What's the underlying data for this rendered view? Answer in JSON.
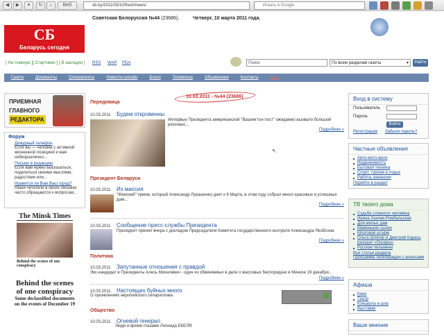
{
  "browser": {
    "url": "sb.by/2011/03/10/fresh/news/",
    "search_placeholder": "Искать в Google",
    "web_btn": "Веб"
  },
  "header": {
    "issue": "Советская Белоруссия №44",
    "issue_num": "(23686),",
    "date": "Четверг, 10 марта 2011 года.",
    "logo_big": "СБ",
    "logo_small": "Беларусь сегодня"
  },
  "toplinks": [
    "[ На главную ]",
    "[ Стартовая ]",
    "[ В закладки ]",
    "RSS",
    "WAP",
    "PDA"
  ],
  "search": {
    "placeholder": "Поиск",
    "scope": "По всем разделам газеты",
    "go": "Найти"
  },
  "nav": [
    "Газета",
    "Документы",
    "Спецпроекты",
    "Новости онлайн",
    "Блоги",
    "Телевизор",
    "Объявления",
    "Контакты",
    "Ещё"
  ],
  "left": {
    "promo_lines": [
      "ПРИЕМНАЯ",
      "ГЛАВНОГО",
      "РЕДАКТОРА"
    ],
    "forum_title": "Форум",
    "forum_items": [
      {
        "title": "Дежурный телефон",
        "text": "Если вы — человек с активной жизненной позицией и вам небезразлично..."
      },
      {
        "title": "Письмо в редакцию",
        "text": "Если вам нужно высказаться, поделиться своими мыслями, радостями или..."
      },
      {
        "title": "Нравится ли Вам Ваш город?",
        "text": "Наши читатели в своих письмах часто обращаются к вопросам..."
      }
    ],
    "minsk": "The Minsk Times",
    "behind": "Behind the scenes of one conspiracy",
    "big1": "Behind the scenes",
    "big2": "of one conspiracy",
    "sub1": "Some declassified documents",
    "sub2": "on the events of December 19"
  },
  "main": {
    "issue_line": "10.03.2011 - №44 (23686)",
    "s1": "Передовица",
    "a1": {
      "date": "10.03.2011",
      "title": "Будем откровенны",
      "text": "Интервью Президента американской \"Вашингтон пост\" ожидаемо вызвало большой резонанс..."
    },
    "s2": "Президент Беларуси",
    "a2": {
      "date": "10.03.2011",
      "title": "Их миссия",
      "text": "\"Женский\" прием, который Александр Лукашенко дает к 8 Марта, в этом году собрал много красивых и успешных дам..."
    },
    "a3": {
      "date": "10.03.2011",
      "title": "Сообщение пресс-службы Президента",
      "text": "Президент принял вчера с докладом Председателя Комитета государственного контроля Александра Якобсона"
    },
    "s3": "Политика",
    "a4": {
      "date": "10.03.2011",
      "title": "Запутанные отношения с правдой",
      "text": "Экс-кандидат в Президенты Алесь Михалевич - один из обвиняемых в деле о массовых беспорядках в Минске 19 декабря..."
    },
    "a5": {
      "date": "10.03.2011",
      "title": "Настоящих буйных много",
      "text": "О проявлениях европейского сепаратизма"
    },
    "s4": "Общество",
    "a6": {
      "date": "10.03.2011",
      "title": "Огневой генерал",
      "text": "Люди и время глазами Леонида ЕКЕЛЯ"
    },
    "more": "Подробнее »"
  },
  "login": {
    "title": "Вход в систему",
    "user": "Пользователь",
    "pass": "Пароль",
    "btn": "Войти",
    "reg": "Регистрация",
    "forgot": "Забыли пароль?"
  },
  "ads": {
    "title": "Частные объявления",
    "items": [
      "Авто-мото-вело",
      "Недвижимость",
      "Бытовая техника",
      "Спорт, туризм и отдых",
      "Работа, вакансии"
    ],
    "more": "Перейти в раздел"
  },
  "tv": {
    "title": "ТВ твоего дома",
    "items": [
      "Судьба сложного человека",
      "Ирена Ханчик-Ромбальская",
      "Для милых дам",
      "Маменькин сынок",
      "Мозговой штурм",
      "Ольга Шлягер и Дмитрий Карась разодэл «Оскары»",
      "Русские пельмени"
    ],
    "all": "Все статьи раздела",
    "prog": "Программа телепередач с анонсами"
  },
  "afisha": {
    "title": "Афиша",
    "items": [
      "Кино",
      "Театр",
      "Концерты и шоу",
      "Выставки"
    ]
  },
  "opinion": {
    "title": "Ваше мнение"
  }
}
